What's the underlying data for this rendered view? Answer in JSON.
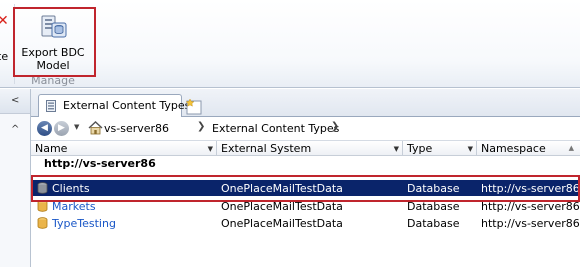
{
  "ribbon": {
    "partial_button_label": "te",
    "export_button_label_line1": "Export BDC",
    "export_button_label_line2": "Model",
    "group_label": "Manage"
  },
  "tabs": [
    {
      "label": "External Content Types"
    }
  ],
  "breadcrumb": {
    "items": [
      "vs-server86",
      "External Content Types"
    ]
  },
  "columns": [
    {
      "label": "Name"
    },
    {
      "label": "External System"
    },
    {
      "label": "Type"
    },
    {
      "label": "Namespace"
    }
  ],
  "group_heading": "http://vs-server86",
  "rows": [
    {
      "name": "Clients",
      "external_system": "OnePlaceMailTestData",
      "type": "Database",
      "namespace": "http://vs-server86",
      "selected": true
    },
    {
      "name": "Markets",
      "external_system": "OnePlaceMailTestData",
      "type": "Database",
      "namespace": "http://vs-server86",
      "selected": false
    },
    {
      "name": "TypeTesting",
      "external_system": "OnePlaceMailTestData",
      "type": "Database",
      "namespace": "http://vs-server86",
      "selected": false
    }
  ],
  "colors": {
    "selection": "#0a246a",
    "highlight_border": "#c0252d",
    "link": "#1a57c7"
  }
}
